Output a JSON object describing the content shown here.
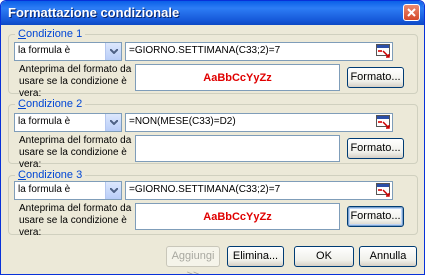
{
  "window": {
    "title": "Formattazione condizionale"
  },
  "conditions": [
    {
      "heading": "Condizione 1",
      "heading_underline": "C",
      "heading_rest": "ondizione 1",
      "type": "la formula è",
      "formula": "=GIORNO.SETTIMANA(C33;2)=7",
      "preview_label": "Anteprima del formato da usare se la condizione è vera:",
      "preview_text": "AaBbCcYyZz",
      "format_button": "Formato..."
    },
    {
      "heading": "Condizione 2",
      "heading_underline": "C",
      "heading_rest": "ondizione 2",
      "type": "la formula è",
      "formula": "=NON(MESE(C33)=D2)",
      "preview_label": "Anteprima del formato da usare se la condizione è vera:",
      "preview_text": "",
      "format_button": "Formato..."
    },
    {
      "heading": "Condizione 3",
      "heading_underline": "C",
      "heading_rest": "ondizione 3",
      "type": "la formula è",
      "formula": "=GIORNO.SETTIMANA(C33;2)=7",
      "preview_label": "Anteprima del formato da usare se la condizione è vera:",
      "preview_text": "AaBbCcYyZz",
      "format_button": "Formato..."
    }
  ],
  "buttons": {
    "add": "Aggiungi >>",
    "delete": "Elimina...",
    "ok": "OK",
    "cancel": "Annulla"
  },
  "colors": {
    "accent": "#0046d5",
    "preview_text": "#e00000",
    "titlebar": "#1659d9"
  }
}
